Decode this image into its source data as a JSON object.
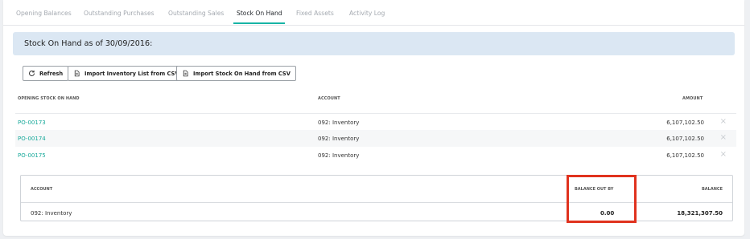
{
  "tabs": [
    {
      "label": "Opening Balances"
    },
    {
      "label": "Outstanding Purchases"
    },
    {
      "label": "Outstanding Sales"
    },
    {
      "label": "Stock On Hand"
    },
    {
      "label": "Fixed Assets"
    },
    {
      "label": "Activity Log"
    }
  ],
  "active_tab": "Stock On Hand",
  "banner": {
    "text": "Stock On Hand as of 30/09/2016:"
  },
  "buttons": {
    "refresh": "Refresh",
    "import_inventory": "Import Inventory List from CSV",
    "import_stock": "Import Stock On Hand from CSV"
  },
  "table": {
    "headers": {
      "opening": "OPENING STOCK ON HAND",
      "account": "ACCOUNT",
      "amount": "AMOUNT"
    },
    "rows": [
      {
        "po": "PO-00173",
        "account": "092: Inventory",
        "amount": "6,107,102.50"
      },
      {
        "po": "PO-00174",
        "account": "092: Inventory",
        "amount": "6,107,102.50"
      },
      {
        "po": "PO-00175",
        "account": "092: Inventory",
        "amount": "6,107,102.50"
      }
    ],
    "remove_glyph": "×"
  },
  "summary": {
    "headers": {
      "account": "ACCOUNT",
      "balance_out_by": "BALANCE OUT BY",
      "balance": "BALANCE"
    },
    "account": "092: Inventory",
    "balance_out_by": "0.00",
    "balance": "18,321,307.50"
  },
  "colors": {
    "accent": "#17b4a5",
    "banner_bg": "#dbe7f3",
    "highlight": "#e0321e"
  },
  "icons": {
    "refresh": "refresh-icon",
    "import": "document-icon"
  }
}
